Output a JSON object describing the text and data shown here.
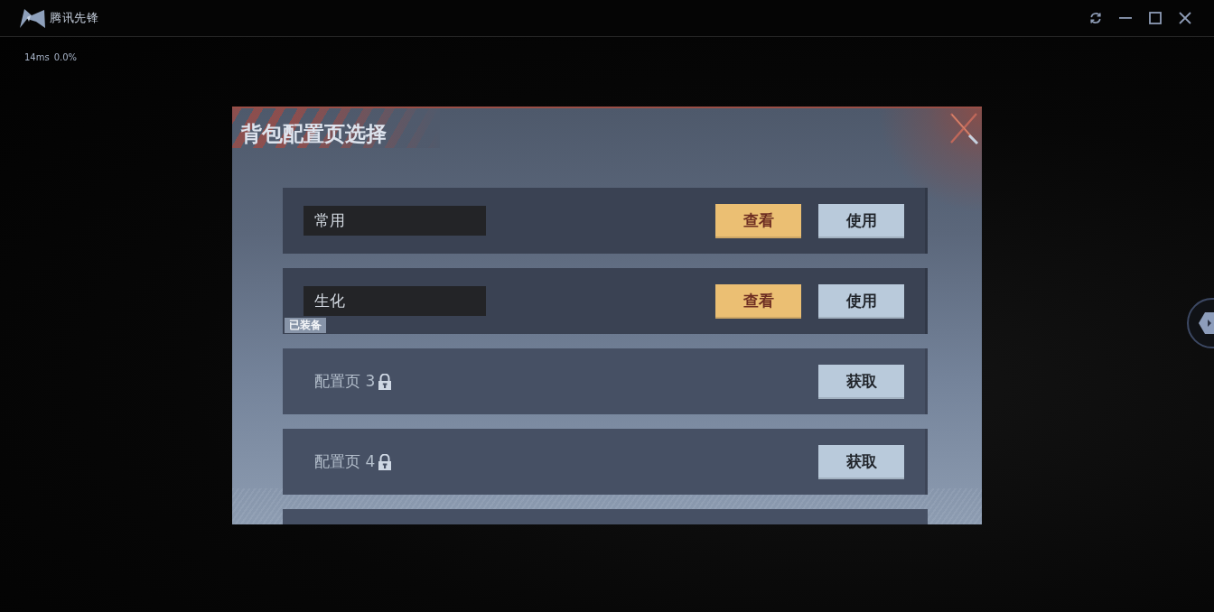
{
  "app": {
    "logo_text": "腾讯先锋",
    "latency": "14ms",
    "loss": "0.0%"
  },
  "dialog": {
    "title": "背包配置页选择",
    "pages": [
      {
        "name": "常用",
        "locked": false,
        "buttons": [
          {
            "kind": "view",
            "label": "查看"
          },
          {
            "kind": "use",
            "label": "使用"
          }
        ]
      },
      {
        "name": "生化",
        "locked": false,
        "badge": "已装备",
        "buttons": [
          {
            "kind": "view",
            "label": "查看"
          },
          {
            "kind": "use",
            "label": "使用"
          }
        ]
      },
      {
        "name": "配置页 3",
        "locked": true,
        "buttons": [
          {
            "kind": "get",
            "label": "获取"
          }
        ]
      },
      {
        "name": "配置页 4",
        "locked": true,
        "buttons": [
          {
            "kind": "get",
            "label": "获取"
          }
        ]
      }
    ]
  }
}
